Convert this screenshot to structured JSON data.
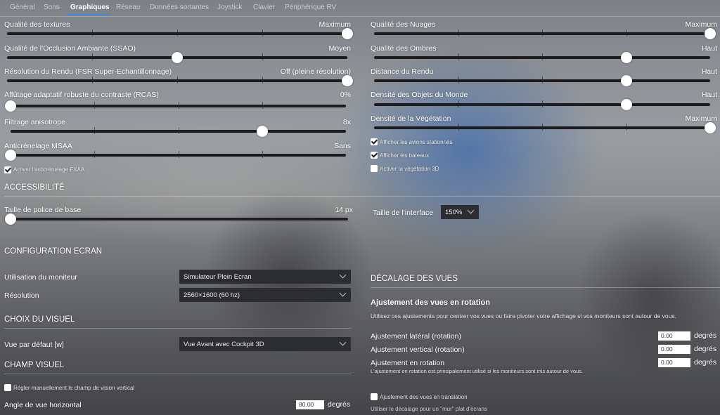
{
  "tabs": [
    "Général",
    "Sons",
    "Graphiques",
    "Réseau",
    "Données sortantes",
    "Joystick",
    "Clavier",
    "Périphérique  RV"
  ],
  "left_sliders": [
    {
      "label": "Qualité des textures",
      "value": "Maximum",
      "position": 1.0
    },
    {
      "label": "Qualité de l'Occlusion Ambiante (SSAO)",
      "value": "Moyen",
      "position": 0.5
    },
    {
      "label": "Résolution du Rendu (FSR Super-Echantillonnage)",
      "value": "Off (pleine résolution)",
      "position": 1.0
    },
    {
      "label": "Affûtage adaptatif robuste du contraste (RCAS)",
      "value": "0%",
      "position": 0.0
    },
    {
      "label": "Filtrage anisotrope",
      "value": "8x",
      "position": 0.75
    },
    {
      "label": "Anticrénelage MSAA",
      "value": "Sans",
      "position": 0.0
    }
  ],
  "fxaa": {
    "label": "Activer l'anticrénelage FXAA",
    "checked": true
  },
  "right_sliders": [
    {
      "label": "Qualité des Nuages",
      "value": "Maximum",
      "position": 1.0
    },
    {
      "label": "Qualité des Ombres",
      "value": "Haut",
      "position": 0.75
    },
    {
      "label": "Distance du Rendu",
      "value": "Haut",
      "position": 0.75
    },
    {
      "label": "Densité des Objets du Monde",
      "value": "Haut",
      "position": 0.75
    },
    {
      "label": "Densité de la Végétation",
      "value": "Maximum",
      "position": 1.0
    }
  ],
  "right_checks": [
    {
      "label": "Afficher les avions stationnés",
      "checked": true
    },
    {
      "label": "Afficher les bateaux",
      "checked": true
    },
    {
      "label": "Activer la végétation 3D",
      "checked": false
    }
  ],
  "accessibility": {
    "title": "ACCESSIBILITÉ",
    "font_size_label": "Taille de police de base",
    "font_size_value": "14 px",
    "font_size_position": 0.0,
    "ui_size_label": "Taille de l'interface",
    "ui_size_value": "150%"
  },
  "screen_config": {
    "title": "CONFIGURATION ECRAN",
    "monitor_label": "Utilisation du moniteur",
    "monitor_value": "Simulateur Plein Ecran",
    "resolution_label": "Résolution",
    "resolution_value": "2560×1600 (60 hz)"
  },
  "visual": {
    "title": "CHOIX DU VISUEL",
    "default_view_label": "Vue par défaut [w]",
    "default_view_value": "Vue Avant avec Cockpit 3D"
  },
  "fov": {
    "title": "CHAMP VISUEL",
    "manual_label": "Régler manuellement le champ de vision vertical",
    "manual_checked": false,
    "h_angle_label": "Angle de vue horizontal",
    "h_angle_value": "80.00",
    "h_angle_unit": "degrés"
  },
  "view_offset": {
    "title": "DÉCALAGE DES VUES",
    "rotation_title": "Ajustement des vues en rotation",
    "rotation_desc": "Utilisez ces ajustements pour centrer vos vues ou faire pivoter votre affichage si vos moniteurs sont autour de vous.",
    "lateral_label": "Ajustement latéral (rotation)",
    "lateral_value": "0.00",
    "vertical_label": "Ajustement vertical (rotation)",
    "vertical_value": "0.00",
    "roll_label": "Ajustement en rotation",
    "roll_value": "0.00",
    "roll_note": "L'ajustement en rotation est principalement utilisé si les moniteurs sont mis autour de vous.",
    "unit": "degrés",
    "translation_label": "Ajustement des vues en translation",
    "translation_checked": false,
    "translation_desc": "Utiliser le décalage pour un \"mur\" plat d'écrans"
  }
}
